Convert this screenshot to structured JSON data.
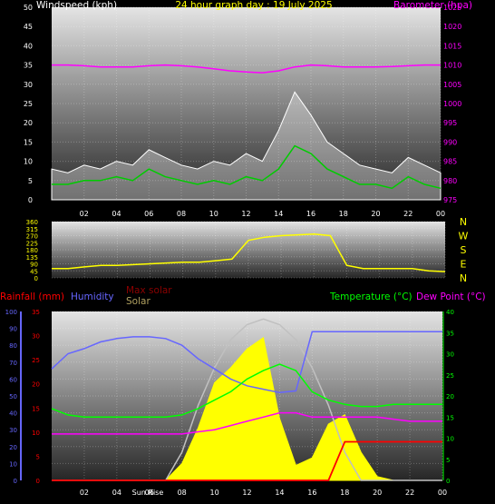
{
  "header": {
    "title": "24 hour graph day : 19 July 2025",
    "wind_label": "Windspeed (kph)",
    "baro_label": "Barometer (hpa)"
  },
  "legend": {
    "rainfall": "Rainfall (mm)",
    "humidity": "Humidity",
    "max_solar": "Max solar",
    "solar": "Solar",
    "temperature": "Temperature (°C)",
    "dew_point": "Dew Point (°C)",
    "sunrise": "Sun Rise"
  },
  "compass": [
    "N",
    "W",
    "S",
    "E",
    "N"
  ],
  "x_ticks": [
    "02",
    "04",
    "06",
    "08",
    "10",
    "12",
    "14",
    "16",
    "18",
    "20",
    "22",
    "00"
  ],
  "colors": {
    "wind_gust": "#ffffff",
    "wind_avg": "#00cc00",
    "barometer": "#ff00ff",
    "direction": "#ffff00",
    "rainfall": "#ff0000",
    "humidity": "#6666ff",
    "max_solar": "#c0c0c0",
    "solar": "#ffff00",
    "temperature": "#00ff00",
    "dew_point": "#ff00ff"
  },
  "chart_data": [
    {
      "type": "line",
      "name": "wind-barometer",
      "x": [
        0,
        1,
        2,
        3,
        4,
        5,
        6,
        7,
        8,
        9,
        10,
        11,
        12,
        13,
        14,
        15,
        16,
        17,
        18,
        19,
        20,
        21,
        22,
        23,
        24
      ],
      "series": [
        {
          "name": "Windspeed (kph)",
          "axis": "left",
          "values": [
            8,
            7,
            9,
            8,
            10,
            9,
            13,
            11,
            9,
            8,
            10,
            9,
            12,
            10,
            18,
            28,
            22,
            15,
            12,
            9,
            8,
            7,
            11,
            9,
            7
          ]
        },
        {
          "name": "Wind average",
          "axis": "left",
          "values": [
            4,
            4,
            5,
            5,
            6,
            5,
            8,
            6,
            5,
            4,
            5,
            4,
            6,
            5,
            8,
            14,
            12,
            8,
            6,
            4,
            4,
            3,
            6,
            4,
            3
          ]
        },
        {
          "name": "Barometer (hpa)",
          "axis": "right",
          "values": [
            1010,
            1010,
            1009.8,
            1009.5,
            1009.5,
            1009.5,
            1009.8,
            1010,
            1009.8,
            1009.5,
            1009,
            1008.5,
            1008.2,
            1008,
            1008.5,
            1009.5,
            1010,
            1009.8,
            1009.5,
            1009.5,
            1009.5,
            1009.6,
            1009.8,
            1010,
            1010
          ]
        }
      ],
      "ylim_left": [
        0,
        50
      ],
      "ylim_right": [
        975,
        1025
      ],
      "yticks_left": [
        0,
        5,
        10,
        15,
        20,
        25,
        30,
        35,
        40,
        45,
        50
      ],
      "yticks_right": [
        975,
        980,
        985,
        990,
        995,
        1000,
        1005,
        1010,
        1015,
        1020,
        1025
      ],
      "grid": true
    },
    {
      "type": "line",
      "name": "wind-direction",
      "x": [
        0,
        1,
        2,
        3,
        4,
        5,
        6,
        7,
        8,
        9,
        10,
        11,
        12,
        13,
        14,
        15,
        16,
        17,
        18,
        19,
        20,
        21,
        22,
        23,
        24
      ],
      "series": [
        {
          "name": "Wind direction",
          "values": [
            60,
            60,
            70,
            80,
            80,
            85,
            90,
            95,
            100,
            100,
            110,
            120,
            240,
            260,
            270,
            275,
            280,
            270,
            80,
            60,
            60,
            60,
            60,
            45,
            40
          ]
        }
      ],
      "ylim": [
        0,
        360
      ],
      "yticks": [
        0,
        45,
        90,
        135,
        180,
        225,
        270,
        315,
        360
      ],
      "grid": true
    },
    {
      "type": "line",
      "name": "temperature-solar",
      "x": [
        0,
        1,
        2,
        3,
        4,
        5,
        6,
        7,
        8,
        9,
        10,
        11,
        12,
        13,
        14,
        15,
        16,
        17,
        18,
        19,
        20,
        21,
        22,
        23,
        24
      ],
      "series": [
        {
          "name": "Humidity",
          "axis": "humidity",
          "values": [
            66,
            75,
            78,
            82,
            84,
            85,
            85,
            84,
            80,
            72,
            66,
            60,
            56,
            54,
            52,
            53,
            88,
            88,
            88,
            88,
            88,
            88,
            88,
            88,
            88
          ]
        },
        {
          "name": "Temperature (°C)",
          "axis": "temp",
          "values": [
            17,
            15.5,
            15,
            15,
            15,
            15,
            15,
            15,
            15.5,
            17,
            19,
            21,
            24,
            26,
            27.5,
            26,
            21,
            19,
            18,
            17.5,
            17.5,
            18,
            18,
            18,
            18
          ]
        },
        {
          "name": "Dew Point (°C)",
          "axis": "temp",
          "values": [
            11,
            11,
            11,
            11,
            11,
            11,
            11,
            11,
            11,
            11.5,
            12,
            13,
            14,
            15,
            16,
            16,
            15,
            15,
            15,
            15,
            15,
            14.5,
            14,
            14,
            14
          ]
        },
        {
          "name": "Max solar",
          "axis": "solar",
          "values": [
            0,
            0,
            0,
            0,
            0,
            0,
            0,
            0,
            150,
            400,
            600,
            750,
            830,
            860,
            830,
            750,
            600,
            400,
            150,
            0,
            0,
            0,
            0,
            0,
            0
          ]
        },
        {
          "name": "Solar",
          "axis": "solar",
          "values": [
            0,
            0,
            0,
            0,
            0,
            0,
            0,
            0,
            90,
            280,
            520,
            600,
            700,
            760,
            330,
            80,
            120,
            300,
            350,
            150,
            20,
            0,
            0,
            0,
            0
          ]
        },
        {
          "name": "Rainfall (mm)",
          "axis": "rain",
          "values": [
            0,
            0,
            0,
            0,
            0,
            0,
            0,
            0,
            0,
            0,
            0,
            0,
            0,
            0,
            0,
            0,
            0,
            0,
            8,
            8,
            8,
            8,
            8,
            8,
            8
          ]
        }
      ],
      "ylim_humidity": [
        0,
        100
      ],
      "ylim_rain": [
        0,
        35
      ],
      "ylim_temp": [
        0,
        40
      ],
      "yticks_humidity": [
        0,
        10,
        20,
        30,
        40,
        50,
        60,
        70,
        80,
        90,
        100
      ],
      "yticks_rain": [
        0,
        5,
        10,
        15,
        20,
        25,
        30,
        35
      ],
      "yticks_temp": [
        0,
        5,
        10,
        15,
        20,
        25,
        30,
        35,
        40
      ],
      "grid": true
    }
  ]
}
